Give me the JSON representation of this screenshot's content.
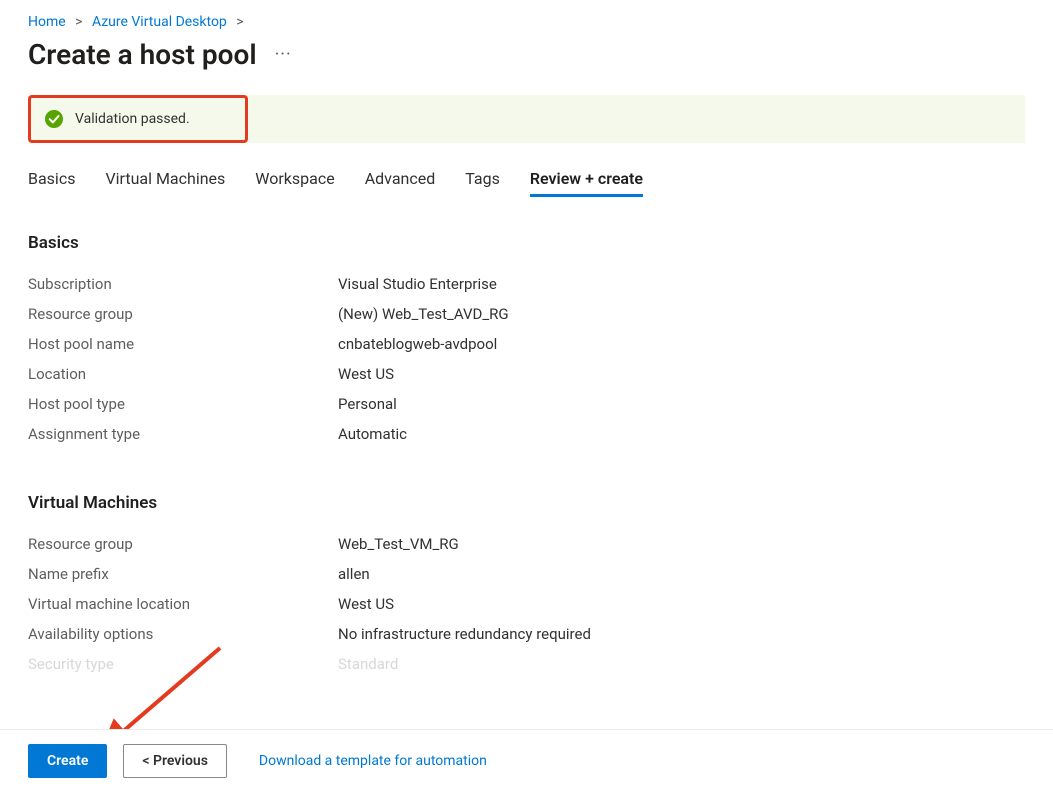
{
  "breadcrumb": {
    "home": "Home",
    "avd": "Azure Virtual Desktop"
  },
  "page": {
    "title": "Create a host pool",
    "more": "···"
  },
  "validation": {
    "message": "Validation passed."
  },
  "tabs": {
    "basics": "Basics",
    "vms": "Virtual Machines",
    "workspace": "Workspace",
    "advanced": "Advanced",
    "tags": "Tags",
    "review": "Review + create"
  },
  "sections": {
    "basics": {
      "heading": "Basics",
      "rows": {
        "subscription": {
          "label": "Subscription",
          "value": "Visual Studio Enterprise"
        },
        "resource_group": {
          "label": "Resource group",
          "value": "(New) Web_Test_AVD_RG"
        },
        "host_pool_name": {
          "label": "Host pool name",
          "value": "cnbateblogweb-avdpool"
        },
        "location": {
          "label": "Location",
          "value": "West US"
        },
        "host_pool_type": {
          "label": "Host pool type",
          "value": "Personal"
        },
        "assignment_type": {
          "label": "Assignment type",
          "value": "Automatic"
        }
      }
    },
    "vms": {
      "heading": "Virtual Machines",
      "rows": {
        "resource_group": {
          "label": "Resource group",
          "value": "Web_Test_VM_RG"
        },
        "name_prefix": {
          "label": "Name prefix",
          "value": "allen"
        },
        "vm_location": {
          "label": "Virtual machine location",
          "value": "West US"
        },
        "availability": {
          "label": "Availability options",
          "value": "No infrastructure redundancy required"
        },
        "security_type": {
          "label": "Security type",
          "value": "Standard"
        }
      }
    }
  },
  "footer": {
    "create": "Create",
    "previous": "< Previous",
    "download": "Download a template for automation"
  }
}
